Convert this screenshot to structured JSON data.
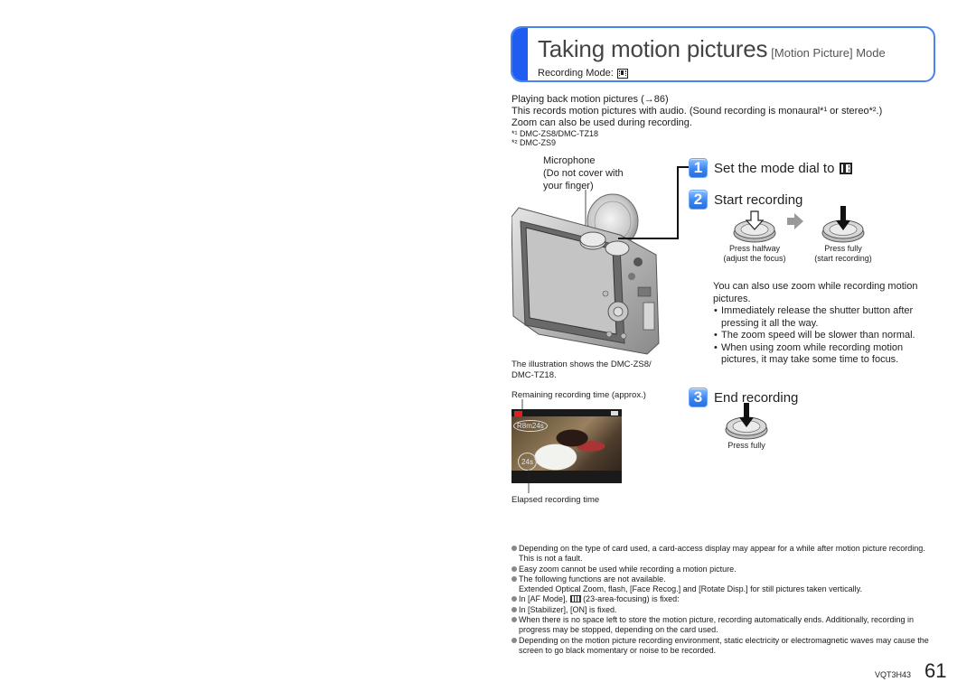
{
  "header": {
    "title": "Taking motion pictures",
    "subtitle": "[Motion Picture] Mode",
    "recording_mode_label": "Recording Mode:",
    "recording_mode_icon": "motion-picture-film-icon",
    "accent_color": "#1f5cf2",
    "border_color": "#4a82f0"
  },
  "intro": {
    "line1": "Playing back motion pictures (→86)",
    "line2": "This records motion pictures with audio. (Sound recording is monaural*¹ or stereo*².)",
    "line3": "Zoom can also be used during recording.",
    "footnote1": "*¹ DMC-ZS8/DMC-TZ18",
    "footnote2": "*² DMC-ZS9"
  },
  "camera_figure": {
    "mic_label_line1": "Microphone",
    "mic_label_line2": "(Do not cover with",
    "mic_label_line3": "your finger)",
    "caption_line1": "The illustration shows the DMC-ZS8/",
    "caption_line2": "DMC-TZ18."
  },
  "lcd_figure": {
    "remaining_label": "Remaining recording time (approx.)",
    "remaining_value": "R8m24s",
    "elapsed_value": "24s",
    "elapsed_label": "Elapsed recording time"
  },
  "steps": [
    {
      "number": "1",
      "label": "Set the mode dial to",
      "icon": "motion-picture-dial-icon"
    },
    {
      "number": "2",
      "label": "Start recording",
      "buttons": [
        {
          "caption_line1": "Press halfway",
          "caption_line2": "(adjust the focus)"
        },
        {
          "caption_line1": "Press fully",
          "caption_line2": "(start recording)"
        }
      ]
    },
    {
      "number": "3",
      "label": "End recording",
      "buttons": [
        {
          "caption_line1": "Press fully"
        }
      ]
    }
  ],
  "zoom_info": {
    "intro": "You can also use zoom while recording motion pictures.",
    "bullets": [
      "Immediately release the shutter button after pressing it all the way.",
      "The zoom speed will be slower than normal.",
      "When using zoom while recording motion pictures, it may take some time to focus."
    ]
  },
  "notes": [
    "Depending on the type of card used, a card-access display may appear for a while after motion picture recording. This is not a fault.",
    "Easy zoom cannot be used while recording a motion picture.",
    "The following functions are not available.",
    "Extended Optical Zoom, flash, [Face Recog.] and [Rotate Disp.] for still pictures taken vertically.",
    "In [AF Mode],",
    "(23-area-focusing) is fixed:",
    "In [Stabilizer], [ON] is fixed.",
    "When there is no space left to store the motion picture, recording automatically ends. Additionally, recording in progress may be stopped, depending on the card used.",
    "Depending on the motion picture recording environment, static electricity or electromagnetic waves may cause the screen to go black momentary or noise to be recorded."
  ],
  "footer": {
    "code": "VQT3H43",
    "page_number": "61"
  }
}
